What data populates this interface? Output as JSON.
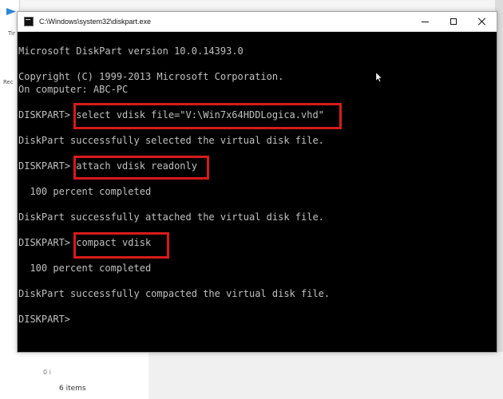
{
  "desktop": {
    "left_tiny_text_top": "Tir",
    "left_tiny_text_middle": "Rec",
    "left_small_text_bottom": "0 i",
    "status_items": "6 items"
  },
  "console": {
    "title": "C:\\Windows\\system32\\diskpart.exe",
    "lines": [
      "Microsoft DiskPart version 10.0.14393.0",
      "",
      "Copyright (C) 1999-2013 Microsoft Corporation.",
      "On computer: ABC-PC",
      "",
      "DISKPART> select vdisk file=\"V:\\Win7x64HDDLogica.vhd\"",
      "",
      "DiskPart successfully selected the virtual disk file.",
      "",
      "DISKPART> attach vdisk readonly",
      "",
      "  100 percent completed",
      "",
      "DiskPart successfully attached the virtual disk file.",
      "",
      "DISKPART> compact vdisk",
      "",
      "  100 percent completed",
      "",
      "DiskPart successfully compacted the virtual disk file.",
      "",
      "DISKPART>"
    ],
    "highlights": {
      "color": "#d71b1b"
    }
  },
  "colors": {
    "console_background": "#000000",
    "console_text": "#c0c0c0",
    "titlebar_background": "#ffffff"
  }
}
